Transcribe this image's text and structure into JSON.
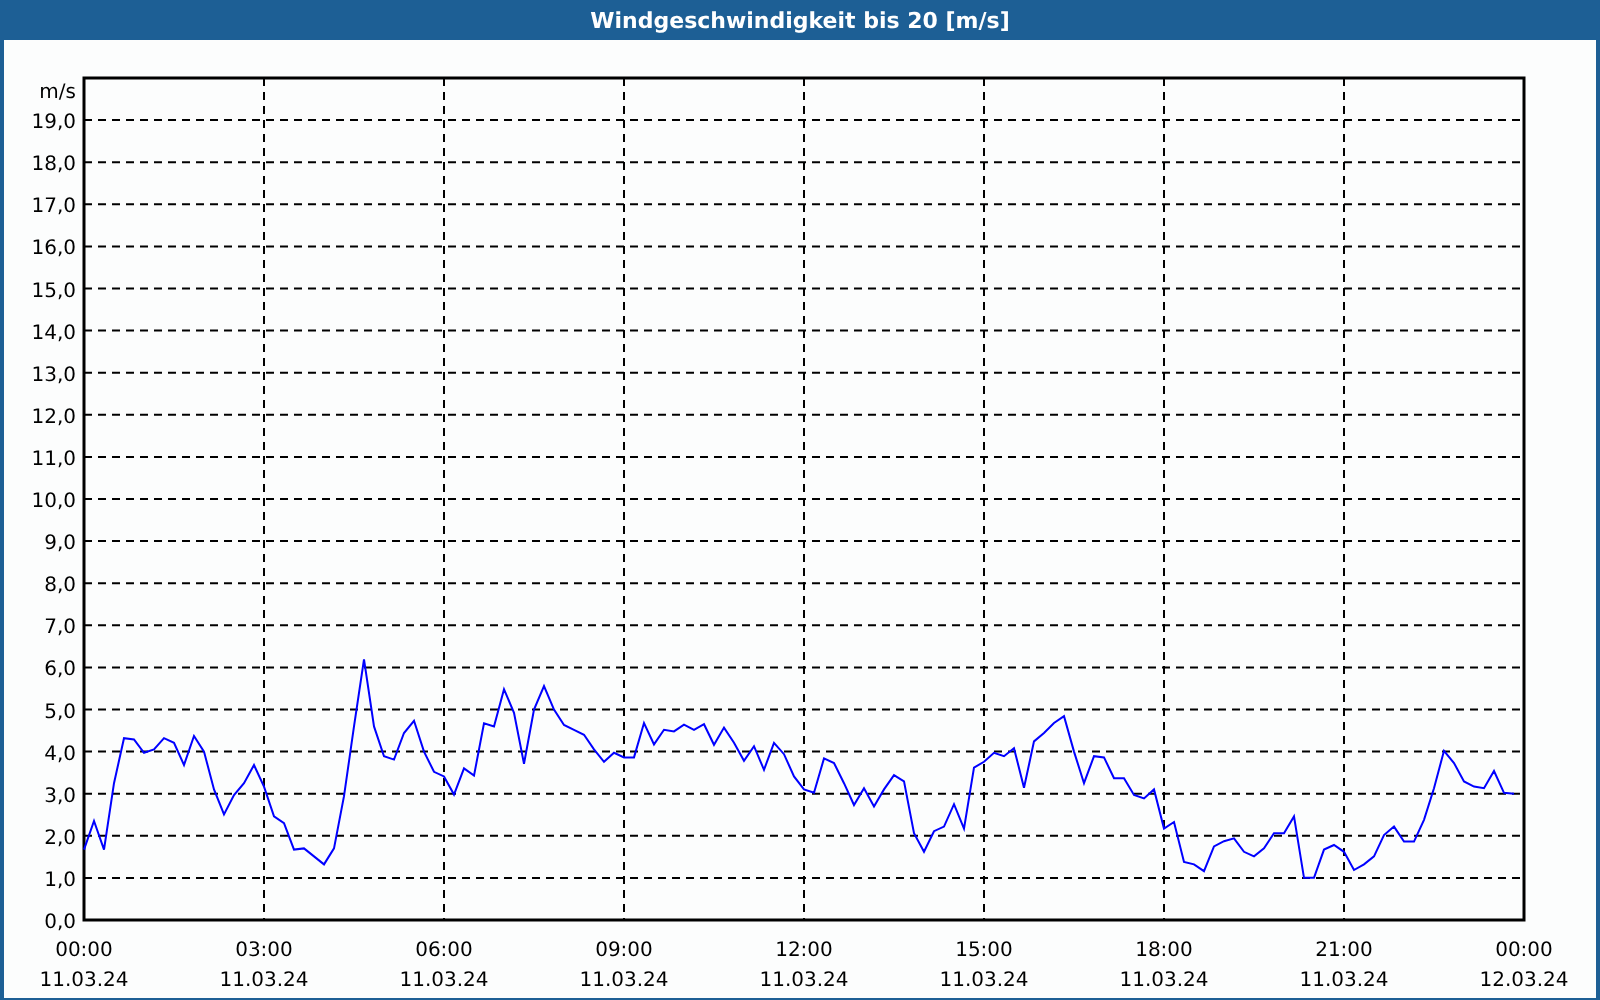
{
  "chart_data": {
    "type": "line",
    "title": "Windgeschwindigkeit bis 20 [m/s]",
    "ylabel": "m/s",
    "grid": true,
    "categories": [
      "00:00\n11.03.24",
      null,
      null,
      null,
      null,
      null,
      null,
      null,
      null,
      null,
      null,
      null,
      null,
      null,
      null,
      null,
      null,
      null,
      "03:00\n11.03.24",
      null,
      null,
      null,
      null,
      null,
      null,
      null,
      null,
      null,
      null,
      null,
      null,
      null,
      null,
      null,
      null,
      null,
      "06:00\n11.03.24",
      null,
      null,
      null,
      null,
      null,
      null,
      null,
      null,
      null,
      null,
      null,
      null,
      null,
      null,
      null,
      null,
      null,
      "09:00\n11.03.24",
      null,
      null,
      null,
      null,
      null,
      null,
      null,
      null,
      null,
      null,
      null,
      null,
      null,
      null,
      null,
      null,
      null,
      "12:00\n11.03.24",
      null,
      null,
      null,
      null,
      null,
      null,
      null,
      null,
      null,
      null,
      null,
      null,
      null,
      null,
      null,
      null,
      null,
      "15:00\n11.03.24",
      null,
      null,
      null,
      null,
      null,
      null,
      null,
      null,
      null,
      null,
      null,
      null,
      null,
      null,
      null,
      null,
      null,
      "18:00\n11.03.24",
      null,
      null,
      null,
      null,
      null,
      null,
      null,
      null,
      null,
      null,
      null,
      null,
      null,
      null,
      null,
      null,
      null,
      "21:00\n11.03.24",
      null,
      null,
      null,
      null,
      null,
      null,
      null,
      null,
      null,
      null,
      null,
      null,
      null,
      null,
      null,
      null,
      null,
      "00:00\n12.03.24"
    ],
    "series": [
      {
        "color": "#0000ff",
        "values": [
          1.67,
          2.35,
          1.67,
          3.25,
          4.32,
          4.29,
          3.97,
          4.05,
          4.32,
          4.21,
          3.68,
          4.37,
          4.0,
          3.1,
          2.51,
          2.97,
          3.25,
          3.68,
          3.17,
          2.46,
          2.3,
          1.67,
          1.7,
          1.51,
          1.32,
          1.7,
          2.94,
          4.6,
          6.19,
          4.6,
          3.89,
          3.81,
          4.44,
          4.73,
          4.0,
          3.52,
          3.41,
          2.98,
          3.6,
          3.43,
          4.67,
          4.6,
          5.48,
          4.92,
          3.71,
          5.0,
          5.56,
          5.0,
          4.63,
          4.52,
          4.4,
          4.05,
          3.76,
          3.97,
          3.86,
          3.86,
          4.68,
          4.17,
          4.52,
          4.48,
          4.64,
          4.52,
          4.65,
          4.16,
          4.57,
          4.21,
          3.78,
          4.13,
          3.57,
          4.21,
          3.94,
          3.41,
          3.1,
          3.02,
          3.84,
          3.73,
          3.25,
          2.73,
          3.13,
          2.7,
          3.1,
          3.44,
          3.29,
          2.06,
          1.62,
          2.11,
          2.22,
          2.75,
          2.17,
          3.62,
          3.76,
          3.97,
          3.89,
          4.08,
          3.14,
          4.24,
          4.44,
          4.68,
          4.84,
          4.0,
          3.25,
          3.89,
          3.86,
          3.37,
          3.37,
          2.97,
          2.89,
          3.1,
          2.17,
          2.33,
          1.38,
          1.32,
          1.16,
          1.75,
          1.87,
          1.94,
          1.62,
          1.51,
          1.7,
          2.06,
          2.06,
          2.46,
          1.0,
          1.0,
          1.67,
          1.78,
          1.62,
          1.19,
          1.32,
          1.51,
          2.02,
          2.22,
          1.86,
          1.86,
          2.38,
          3.13,
          4.02,
          3.73,
          3.29,
          3.17,
          3.13,
          3.54,
          3.02,
          3.0,
          null
        ]
      }
    ],
    "ylim": [
      0,
      20
    ],
    "yticks": [
      {
        "value": 0,
        "label": "0,0"
      },
      {
        "value": 1,
        "label": "1,0"
      },
      {
        "value": 2,
        "label": "2,0"
      },
      {
        "value": 3,
        "label": "3,0"
      },
      {
        "value": 4,
        "label": "4,0"
      },
      {
        "value": 5,
        "label": "5,0"
      },
      {
        "value": 6,
        "label": "6,0"
      },
      {
        "value": 7,
        "label": "7,0"
      },
      {
        "value": 8,
        "label": "8,0"
      },
      {
        "value": 9,
        "label": "9,0"
      },
      {
        "value": 10,
        "label": "10,0"
      },
      {
        "value": 11,
        "label": "11,0"
      },
      {
        "value": 12,
        "label": "12,0"
      },
      {
        "value": 13,
        "label": "13,0"
      },
      {
        "value": 14,
        "label": "14,0"
      },
      {
        "value": 15,
        "label": "15,0"
      },
      {
        "value": 16,
        "label": "16,0"
      },
      {
        "value": 17,
        "label": "17,0"
      },
      {
        "value": 18,
        "label": "18,0"
      },
      {
        "value": 19,
        "label": "19,0"
      }
    ]
  }
}
